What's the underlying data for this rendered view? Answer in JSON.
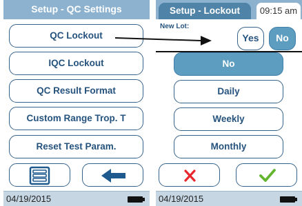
{
  "left": {
    "title": "Setup - QC Settings",
    "buttons": [
      "QC Lockout",
      "IQC Lockout",
      "QC Result Format",
      "Custom Range Trop. T",
      "Reset Test Param."
    ],
    "date": "04/19/2015",
    "icons": {
      "menu": "list-menu-icon",
      "back": "back-arrow-icon",
      "battery": "battery-icon"
    }
  },
  "right": {
    "title": "Setup - Lockout",
    "time": "09:15 am",
    "new_lot_label": "New Lot:",
    "yes_label": "Yes",
    "no_label": "No",
    "options": [
      "No",
      "Daily",
      "Weekly",
      "Monthly"
    ],
    "selected_option": "No",
    "date": "04/19/2015",
    "icons": {
      "cancel": "cancel-x-icon",
      "confirm": "confirm-check-icon",
      "battery": "battery-icon"
    }
  },
  "colors": {
    "header_bg": "#8cb2cf",
    "tab_bg": "#4f83a8",
    "selected_bg": "#5c9dc0",
    "button_border": "#36628a",
    "button_text": "#25537e",
    "footer_bg": "#c6d6e3",
    "back_arrow": "#1f5a8f",
    "cancel": "#e8262b",
    "confirm": "#63b52e"
  }
}
